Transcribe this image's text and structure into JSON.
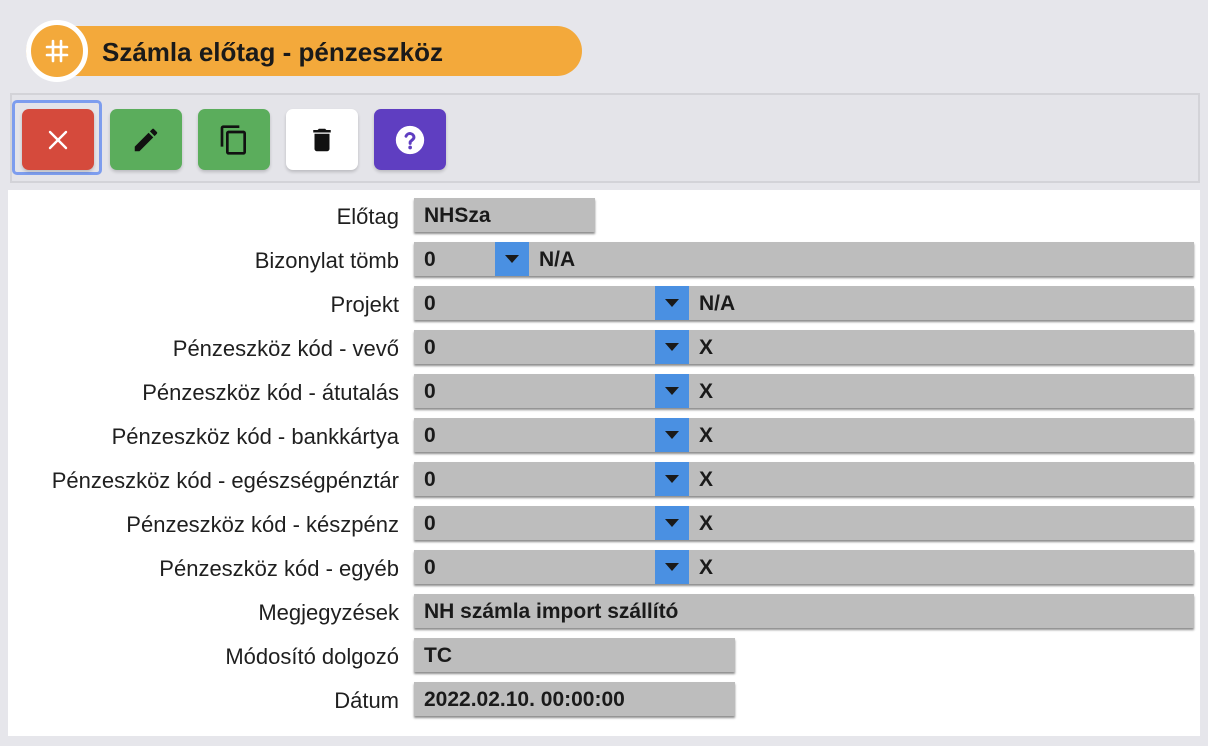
{
  "header": {
    "title": "Számla előtag - pénzeszköz",
    "icon": "hash-icon"
  },
  "toolbar": {
    "buttons": [
      {
        "name": "close",
        "icon": "close-icon",
        "color": "#d54a3c"
      },
      {
        "name": "edit",
        "icon": "pencil-icon",
        "color": "#5bad5c"
      },
      {
        "name": "copy",
        "icon": "copy-icon",
        "color": "#5bad5c"
      },
      {
        "name": "delete",
        "icon": "trash-icon",
        "color": "#ffffff"
      },
      {
        "name": "help",
        "icon": "help-icon",
        "color": "#5f3ec1"
      }
    ]
  },
  "form": {
    "elotag": {
      "label": "Előtag",
      "value": "NHSza"
    },
    "bizonylat_tomb": {
      "label": "Bizonylat tömb",
      "value": "0",
      "description": "N/A"
    },
    "projekt": {
      "label": "Projekt",
      "value": "0",
      "description": "N/A"
    },
    "vevo": {
      "label": "Pénzeszköz kód - vevő",
      "value": "0",
      "description": "X"
    },
    "atutalas": {
      "label": "Pénzeszköz kód - átutalás",
      "value": "0",
      "description": "X"
    },
    "bankkartya": {
      "label": "Pénzeszköz kód - bankkártya",
      "value": "0",
      "description": "X"
    },
    "egeszsegpenztar": {
      "label": "Pénzeszköz kód - egészségpénztár",
      "value": "0",
      "description": "X"
    },
    "keszpenz": {
      "label": "Pénzeszköz kód - készpénz",
      "value": "0",
      "description": "X"
    },
    "egyeb": {
      "label": "Pénzeszköz kód - egyéb",
      "value": "0",
      "description": "X"
    },
    "megjegyzesek": {
      "label": "Megjegyzések",
      "value": "NH számla import szállító"
    },
    "modosito": {
      "label": "Módosító dolgozó",
      "value": "TC"
    },
    "datum": {
      "label": "Dátum",
      "value": "2022.02.10. 00:00:00"
    }
  }
}
